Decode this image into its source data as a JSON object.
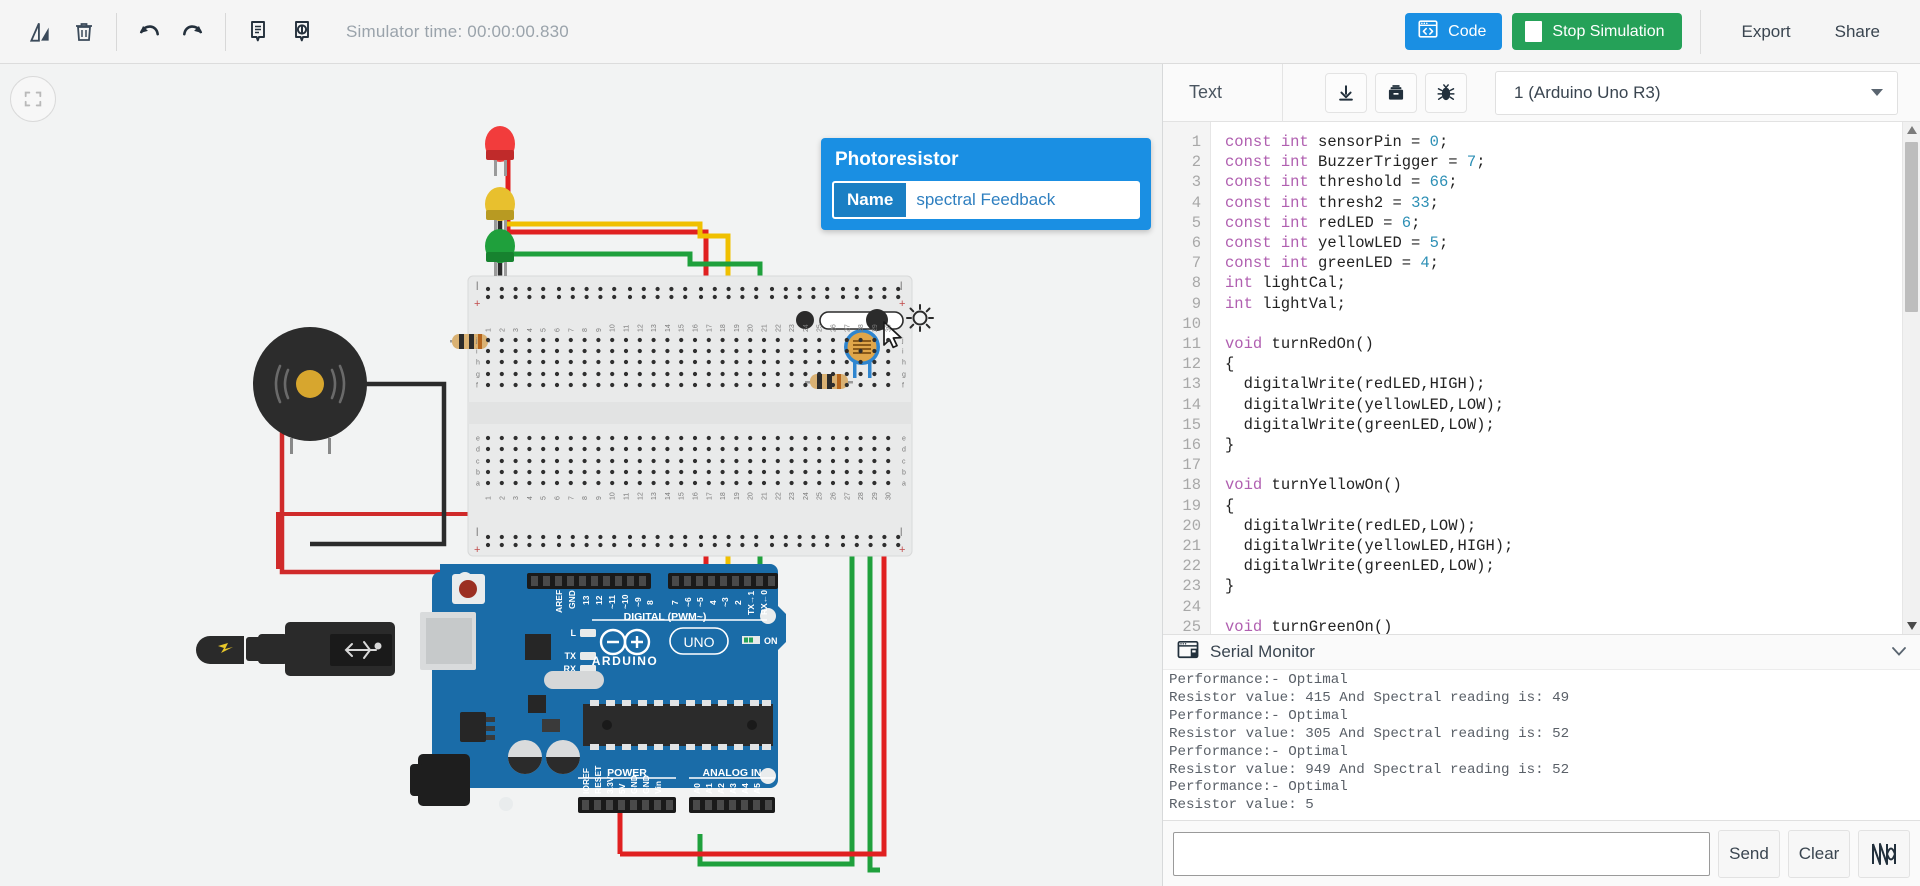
{
  "toolbar": {
    "icons": [
      {
        "name": "rotate-icon",
        "title": "Rotate"
      },
      {
        "name": "delete-icon",
        "title": "Delete"
      },
      {
        "name": "undo-icon",
        "title": "Undo"
      },
      {
        "name": "redo-icon",
        "title": "Redo"
      },
      {
        "name": "notes-icon",
        "title": "Annotation"
      },
      {
        "name": "inspect-icon",
        "title": "Inspect"
      }
    ],
    "sim_time": "Simulator time: 00:00:00.830",
    "code_label": "Code",
    "stop_label": "Stop Simulation",
    "export_label": "Export",
    "share_label": "Share"
  },
  "canvas": {
    "fit_button": "fit-to-screen",
    "popup": {
      "title": "Photoresistor",
      "name_label": "Name",
      "name_value": "spectral Feedback"
    },
    "board": {
      "brand": "ARDUINO",
      "model": "UNO",
      "on_label": "ON",
      "led_l": "L",
      "led_tx": "TX",
      "led_rx": "RX",
      "digital_header": "DIGITAL (PWM~)",
      "digital_pins": [
        "AREF",
        "GND",
        "13",
        "12",
        "~11",
        "~10",
        "~9",
        "8",
        "7",
        "~6",
        "~5",
        "4",
        "~3",
        "2",
        "TX→1",
        "RX←0"
      ],
      "power_header": "POWER",
      "power_pins": [
        "IOREF",
        "RESET",
        "3.3V",
        "5V",
        "GND",
        "GND",
        "Vin"
      ],
      "analog_header": "ANALOG IN",
      "analog_pins": [
        "A0",
        "A1",
        "A2",
        "A3",
        "A4",
        "A5"
      ]
    },
    "colors": {
      "board_blue": "#1a6ca8",
      "wire_red": "#e02020",
      "wire_green": "#1fa03c",
      "wire_yellow": "#f0c000",
      "wire_black": "#262626",
      "breadboard": "#e9eaea",
      "accent_blue": "#1a8fe3",
      "accent_green": "#25a158"
    }
  },
  "code_panel": {
    "mode_label": "Text",
    "icons": [
      {
        "name": "download-icon"
      },
      {
        "name": "library-icon"
      },
      {
        "name": "debug-bug-icon"
      }
    ],
    "board_selector": "1 (Arduino Uno R3)",
    "lines": [
      {
        "n": 1,
        "t": "const int sensorPin = 0;"
      },
      {
        "n": 2,
        "t": "const int BuzzerTrigger = 7;"
      },
      {
        "n": 3,
        "t": "const int threshold = 66;"
      },
      {
        "n": 4,
        "t": "const int thresh2 = 33;"
      },
      {
        "n": 5,
        "t": "const int redLED = 6;"
      },
      {
        "n": 6,
        "t": "const int yellowLED = 5;"
      },
      {
        "n": 7,
        "t": "const int greenLED = 4;"
      },
      {
        "n": 8,
        "t": "int lightCal;"
      },
      {
        "n": 9,
        "t": "int lightVal;"
      },
      {
        "n": 10,
        "t": ""
      },
      {
        "n": 11,
        "t": "void turnRedOn()"
      },
      {
        "n": 12,
        "t": "{"
      },
      {
        "n": 13,
        "t": "  digitalWrite(redLED,HIGH);"
      },
      {
        "n": 14,
        "t": "  digitalWrite(yellowLED,LOW);"
      },
      {
        "n": 15,
        "t": "  digitalWrite(greenLED,LOW);"
      },
      {
        "n": 16,
        "t": "}"
      },
      {
        "n": 17,
        "t": ""
      },
      {
        "n": 18,
        "t": "void turnYellowOn()"
      },
      {
        "n": 19,
        "t": "{"
      },
      {
        "n": 20,
        "t": "  digitalWrite(redLED,LOW);"
      },
      {
        "n": 21,
        "t": "  digitalWrite(yellowLED,HIGH);"
      },
      {
        "n": 22,
        "t": "  digitalWrite(greenLED,LOW);"
      },
      {
        "n": 23,
        "t": "}"
      },
      {
        "n": 24,
        "t": ""
      },
      {
        "n": 25,
        "t": "void turnGreenOn()"
      }
    ]
  },
  "serial_monitor": {
    "title": "Serial Monitor",
    "output": "Performance:- Optimal\nResistor value: 415 And Spectral reading is: 49\nPerformance:- Optimal\nResistor value: 305 And Spectral reading is: 52\nPerformance:- Optimal\nResistor value: 949 And Spectral reading is: 52\nPerformance:- Optimal\nResistor value: 5",
    "input_value": "",
    "send_label": "Send",
    "clear_label": "Clear",
    "graph_icon": "waveform-icon"
  }
}
